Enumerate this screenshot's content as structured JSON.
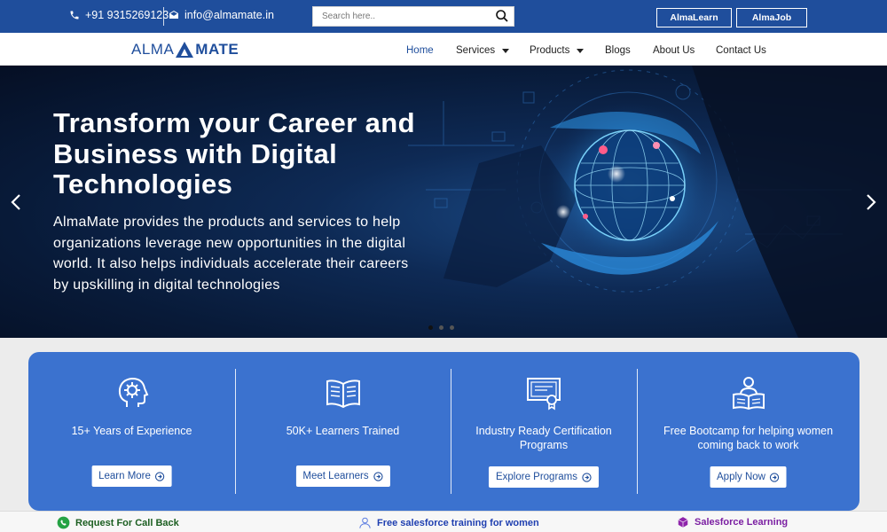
{
  "topbar": {
    "phone": "+91 9315269123",
    "email": "info@almamate.in",
    "search_placeholder": "Search here..",
    "btn_learn": "AlmaLearn",
    "btn_job": "AlmaJob"
  },
  "logo": {
    "left": "ALMA",
    "right": "MATE"
  },
  "nav": {
    "home": "Home",
    "services": "Services",
    "products": "Products",
    "blogs": "Blogs",
    "about": "About Us",
    "contact": "Contact Us"
  },
  "hero": {
    "title": "Transform your Career and Business with Digital Technologies",
    "description": "AlmaMate provides the products and services to help organizations leverage new opportunities in the digital world. It also helps individuals accelerate their careers by upskilling in digital technologies"
  },
  "features": [
    {
      "text": "15+ Years of Experience",
      "button": "Learn More",
      "icon": "brain-gear-icon"
    },
    {
      "text": "50K+ Learners Trained",
      "button": "Meet Learners",
      "icon": "open-book-icon"
    },
    {
      "text": "Industry Ready Certification Programs",
      "button": "Explore Programs",
      "icon": "certificate-icon"
    },
    {
      "text": "Free Bootcamp for helping women coming back to work",
      "button": "Apply Now",
      "icon": "reader-icon"
    }
  ],
  "bottombar": {
    "callback": "Request For Call Back",
    "women": "Free salesforce training for women",
    "salesforce": "Salesforce Learning"
  },
  "colors": {
    "primary": "#1f4e9c",
    "card": "#3b72cf",
    "callback": "#1b5e20",
    "women": "#1f3fb0",
    "salesforce": "#7b1fa2"
  }
}
